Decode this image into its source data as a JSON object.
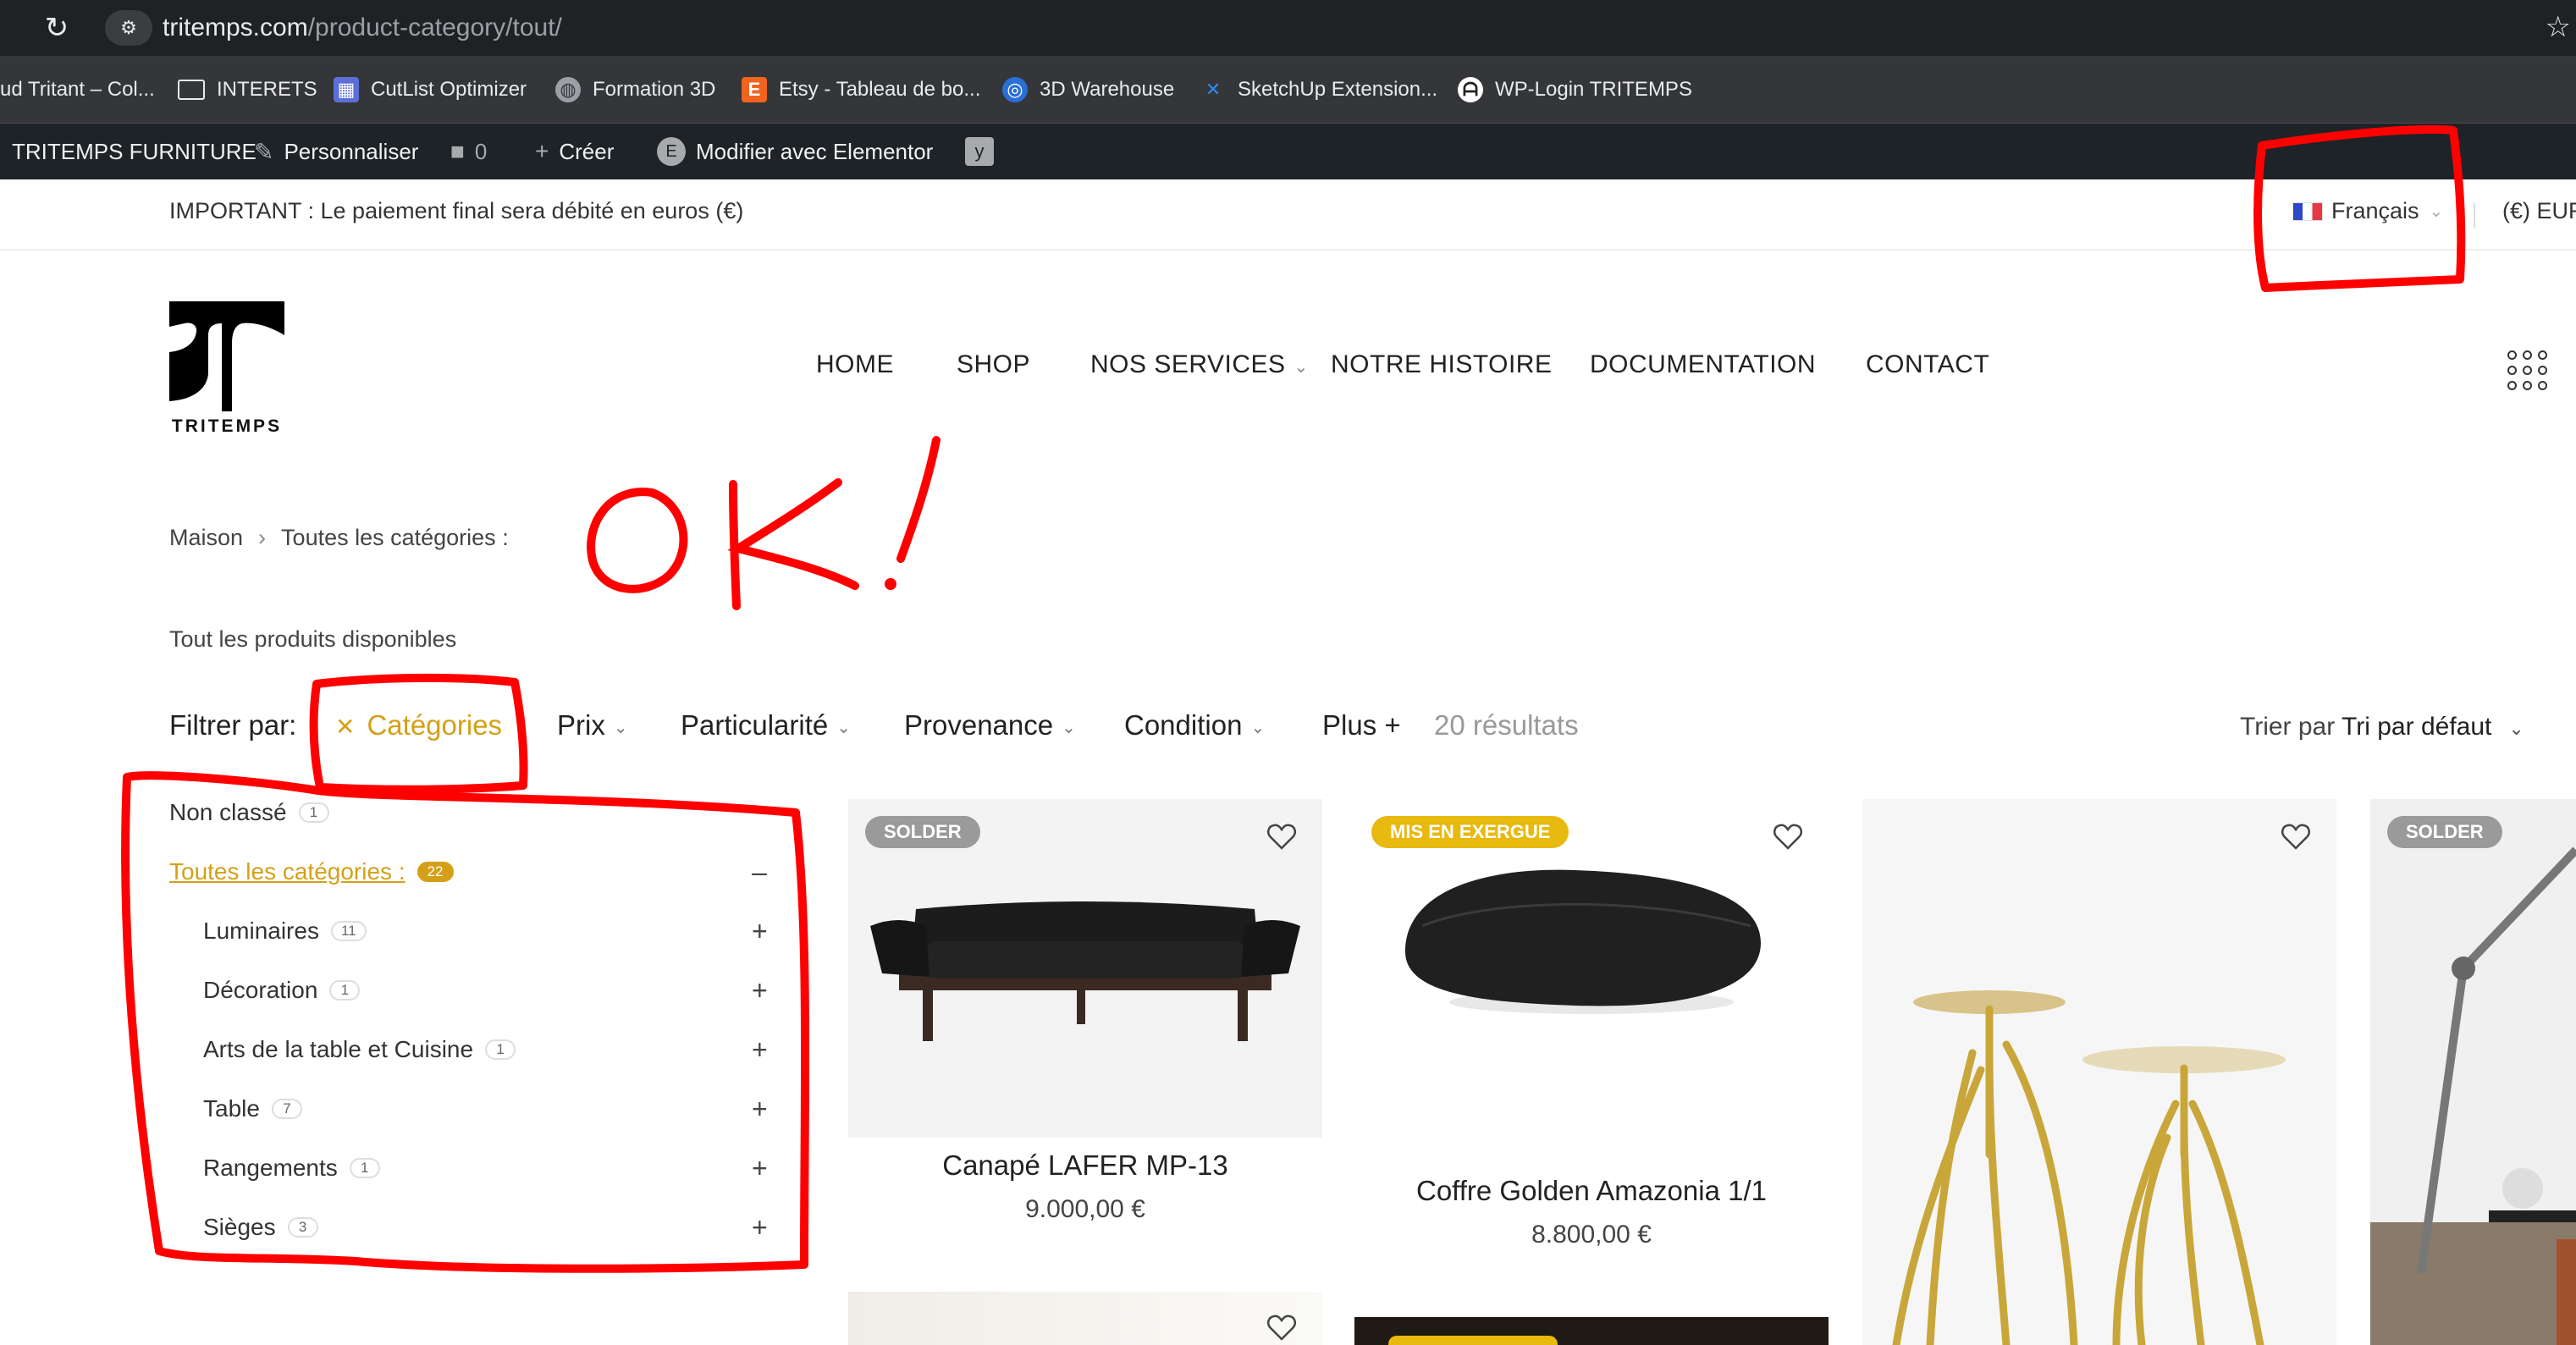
{
  "browser": {
    "url_host": "tritemps.com",
    "url_path": "/product-category/tout/",
    "bookmarks": [
      {
        "label": "ud Tritant – Col...",
        "icon": ""
      },
      {
        "label": "INTERETS",
        "icon": "folder-icon"
      },
      {
        "label": "CutList Optimizer",
        "icon": "cutlist-icon"
      },
      {
        "label": "Formation 3D",
        "icon": "globe-icon"
      },
      {
        "label": "Etsy - Tableau de bo...",
        "icon": "etsy-icon"
      },
      {
        "label": "3D Warehouse",
        "icon": "warehouse-icon"
      },
      {
        "label": "SketchUp Extension...",
        "icon": "sketchup-icon"
      },
      {
        "label": "WP-Login TRITEMPS",
        "icon": "wp-icon"
      }
    ]
  },
  "adminbar": {
    "site": "TRITEMPS FURNITURE",
    "customize": "Personnaliser",
    "comments": "0",
    "create": "Créer",
    "elementor": "Modifier avec Elementor"
  },
  "topbar": {
    "notice": "IMPORTANT : Le paiement final sera débité en euros (€)",
    "language": "Français",
    "currency": "(€) EUR"
  },
  "logo": {
    "text": "TRITEMPS"
  },
  "nav": {
    "items": [
      "HOME",
      "SHOP",
      "NOS SERVICES",
      "NOTRE HISTOIRE",
      "DOCUMENTATION",
      "CONTACT"
    ]
  },
  "breadcrumb": {
    "home": "Maison",
    "current": "Toutes les catégories :"
  },
  "subtitle": "Tout les produits disponibles",
  "filters": {
    "label": "Filtrer par:",
    "active": "Catégories",
    "items": [
      "Prix",
      "Particularité",
      "Provenance",
      "Condition"
    ],
    "more": "Plus +",
    "results": "20 résultats",
    "sort_label": "Trier par",
    "sort_value": "Tri par défaut"
  },
  "categories": [
    {
      "label": "Non classé",
      "count": "1"
    },
    {
      "label": "Toutes les catégories :",
      "count": "22",
      "toggle": "–"
    },
    {
      "label": "Luminaires",
      "count": "11",
      "toggle": "+"
    },
    {
      "label": "Décoration",
      "count": "1",
      "toggle": "+"
    },
    {
      "label": "Arts de la table et Cuisine",
      "count": "1",
      "toggle": "+"
    },
    {
      "label": "Table",
      "count": "7",
      "toggle": "+"
    },
    {
      "label": "Rangements",
      "count": "1",
      "toggle": "+"
    },
    {
      "label": "Sièges",
      "count": "3",
      "toggle": "+"
    }
  ],
  "products": [
    {
      "badge": "SOLDER",
      "title": "Canapé LAFER MP-13",
      "price": "9.000,00 €"
    },
    {
      "badge": "MIS EN EXERGUE",
      "title": "Coffre Golden Amazonia 1/1",
      "price": "8.800,00 €"
    },
    {
      "badge": "",
      "title": "",
      "price": ""
    },
    {
      "badge": "SOLDER",
      "title": "",
      "price": ""
    }
  ],
  "annotation": {
    "text": "OK !"
  },
  "colors": {
    "accent": "#d4a017",
    "annotation": "#ff0000",
    "badge_gold": "#e8b90f",
    "badge_grey": "#9a9a9a"
  }
}
